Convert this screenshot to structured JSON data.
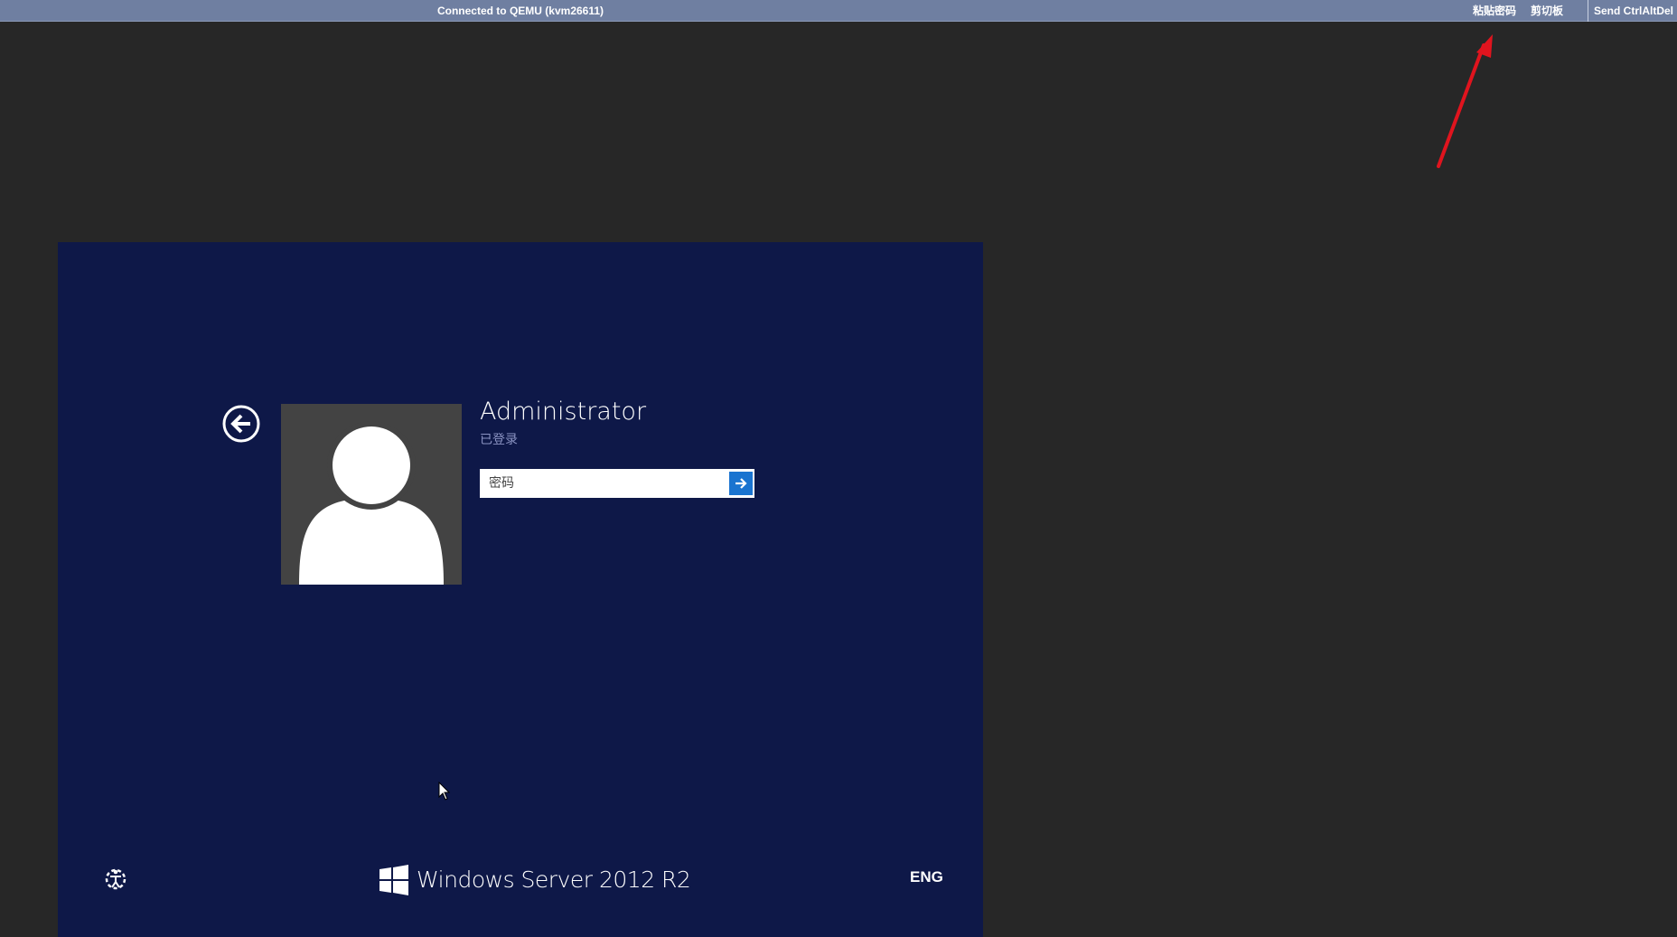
{
  "topbar": {
    "title": "Connected to QEMU (kvm26611)",
    "paste_password_label": "粘贴密码",
    "clipboard_label": "剪切板",
    "send_cad_label": "Send CtrlAltDel"
  },
  "login": {
    "user_name": "Administrator",
    "user_status": "已登录",
    "password_placeholder": "密码",
    "password_value": ""
  },
  "footer": {
    "os_brand": "Windows Server 2012 R2",
    "language": "ENG"
  },
  "icons": {
    "back": "back-arrow-circle-icon",
    "avatar": "user-silhouette-icon",
    "submit": "arrow-right-icon",
    "ease_of_access": "ease-of-access-icon",
    "windows_logo": "windows-logo-icon"
  },
  "colors": {
    "topbar": "#6f7fa1",
    "desktop": "#272727",
    "login_screen": "#0e1848",
    "submit_button": "#1a74d0",
    "annotation_arrow": "#e0141e"
  }
}
